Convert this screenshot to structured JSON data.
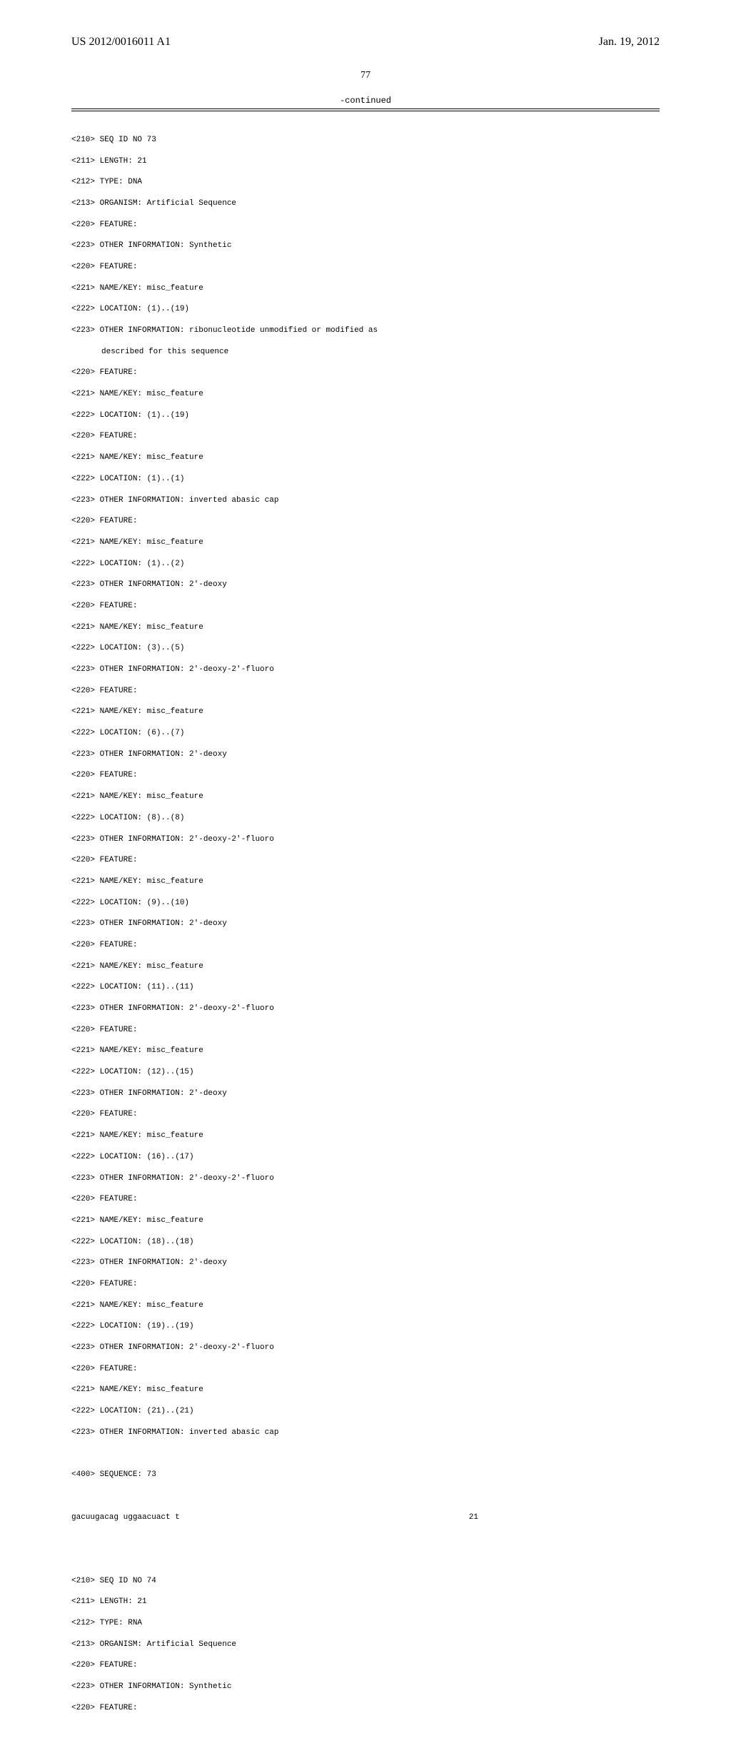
{
  "header": {
    "pub_number": "US 2012/0016011 A1",
    "pub_date": "Jan. 19, 2012"
  },
  "page_number": "77",
  "continued_label": "-continued",
  "seq73": {
    "l01": "<210> SEQ ID NO 73",
    "l02": "<211> LENGTH: 21",
    "l03": "<212> TYPE: DNA",
    "l04": "<213> ORGANISM: Artificial Sequence",
    "l05": "<220> FEATURE:",
    "l06": "<223> OTHER INFORMATION: Synthetic",
    "l07": "<220> FEATURE:",
    "l08": "<221> NAME/KEY: misc_feature",
    "l09": "<222> LOCATION: (1)..(19)",
    "l10": "<223> OTHER INFORMATION: ribonucleotide unmodified or modified as",
    "l10b": "described for this sequence",
    "l11": "<220> FEATURE:",
    "l12": "<221> NAME/KEY: misc_feature",
    "l13": "<222> LOCATION: (1)..(19)",
    "l14": "<220> FEATURE:",
    "l15": "<221> NAME/KEY: misc_feature",
    "l16": "<222> LOCATION: (1)..(1)",
    "l17": "<223> OTHER INFORMATION: inverted abasic cap",
    "l18": "<220> FEATURE:",
    "l19": "<221> NAME/KEY: misc_feature",
    "l20": "<222> LOCATION: (1)..(2)",
    "l21": "<223> OTHER INFORMATION: 2'-deoxy",
    "l22": "<220> FEATURE:",
    "l23": "<221> NAME/KEY: misc_feature",
    "l24": "<222> LOCATION: (3)..(5)",
    "l25": "<223> OTHER INFORMATION: 2'-deoxy-2'-fluoro",
    "l26": "<220> FEATURE:",
    "l27": "<221> NAME/KEY: misc_feature",
    "l28": "<222> LOCATION: (6)..(7)",
    "l29": "<223> OTHER INFORMATION: 2'-deoxy",
    "l30": "<220> FEATURE:",
    "l31": "<221> NAME/KEY: misc_feature",
    "l32": "<222> LOCATION: (8)..(8)",
    "l33": "<223> OTHER INFORMATION: 2'-deoxy-2'-fluoro",
    "l34": "<220> FEATURE:",
    "l35": "<221> NAME/KEY: misc_feature",
    "l36": "<222> LOCATION: (9)..(10)",
    "l37": "<223> OTHER INFORMATION: 2'-deoxy",
    "l38": "<220> FEATURE:",
    "l39": "<221> NAME/KEY: misc_feature",
    "l40": "<222> LOCATION: (11)..(11)",
    "l41": "<223> OTHER INFORMATION: 2'-deoxy-2'-fluoro",
    "l42": "<220> FEATURE:",
    "l43": "<221> NAME/KEY: misc_feature",
    "l44": "<222> LOCATION: (12)..(15)",
    "l45": "<223> OTHER INFORMATION: 2'-deoxy",
    "l46": "<220> FEATURE:",
    "l47": "<221> NAME/KEY: misc_feature",
    "l48": "<222> LOCATION: (16)..(17)",
    "l49": "<223> OTHER INFORMATION: 2'-deoxy-2'-fluoro",
    "l50": "<220> FEATURE:",
    "l51": "<221> NAME/KEY: misc_feature",
    "l52": "<222> LOCATION: (18)..(18)",
    "l53": "<223> OTHER INFORMATION: 2'-deoxy",
    "l54": "<220> FEATURE:",
    "l55": "<221> NAME/KEY: misc_feature",
    "l56": "<222> LOCATION: (19)..(19)",
    "l57": "<223> OTHER INFORMATION: 2'-deoxy-2'-fluoro",
    "l58": "<220> FEATURE:",
    "l59": "<221> NAME/KEY: misc_feature",
    "l60": "<222> LOCATION: (21)..(21)",
    "l61": "<223> OTHER INFORMATION: inverted abasic cap",
    "l62": "<400> SEQUENCE: 73",
    "seq_text": "gacuugacag uggaacuact t",
    "seq_len": "21"
  },
  "seq74": {
    "l01": "<210> SEQ ID NO 74",
    "l02": "<211> LENGTH: 21",
    "l03": "<212> TYPE: RNA",
    "l04": "<213> ORGANISM: Artificial Sequence",
    "l05": "<220> FEATURE:",
    "l06": "<223> OTHER INFORMATION: Synthetic",
    "l07": "<220> FEATURE:"
  }
}
